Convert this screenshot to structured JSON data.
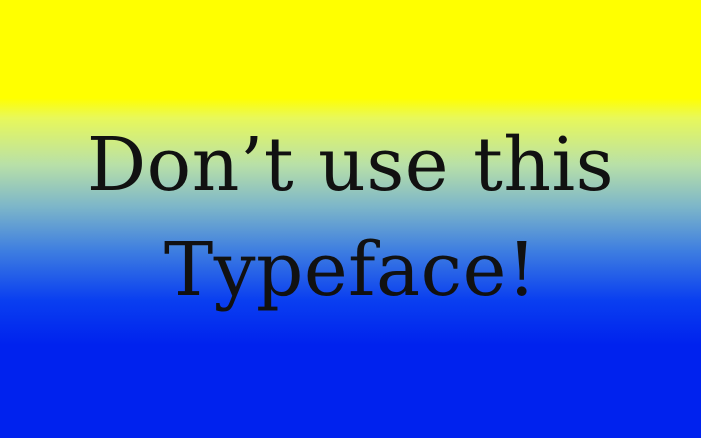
{
  "message": {
    "line1": "Don’t use this",
    "line2": "Typeface!"
  },
  "colors": {
    "top": "#ffff00",
    "bottom": "#0022ee",
    "text": "#111111"
  }
}
